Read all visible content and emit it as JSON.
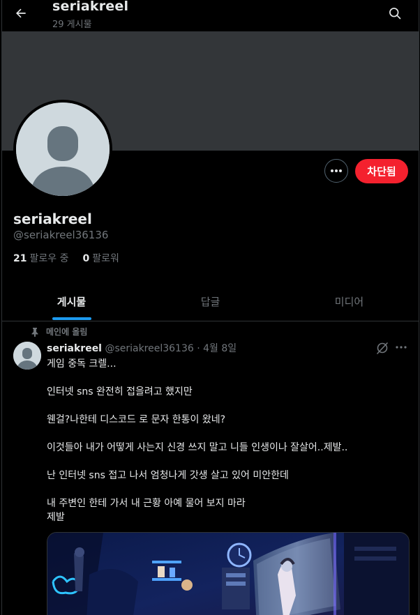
{
  "header": {
    "title": "seriakreel",
    "post_count": "29 게시물"
  },
  "profile": {
    "name": "seriakreel",
    "handle": "@seriakreel36136",
    "following_count": "21",
    "following_label": "팔로우 중",
    "followers_count": "0",
    "followers_label": "팔로워",
    "blocked_label": "차단됨",
    "accent_color": "#f4212e"
  },
  "tabs": [
    {
      "label": "게시물",
      "active": true
    },
    {
      "label": "답글",
      "active": false
    },
    {
      "label": "미디어",
      "active": false
    }
  ],
  "post": {
    "pinned_label": "메인에 올림",
    "author_name": "seriakreel",
    "author_handle": "@seriakreel36136",
    "date": "· 4월 8일",
    "lines": [
      "게임 중독 크렐...",
      "인터넷 sns 완전히 접을려고 했지만",
      "웬걸?나한테 디스코드 로 문자 한통이 왔네?",
      "이것들아 내가 어떻게 사는지 신경 쓰지 말고 니들 인생이나 잘살어..제발..",
      "난 인터넷 sns 접고 나서 엄청나게 갓생 살고 있어 미안한데",
      "내 주변인 한테 가서 내 근황 아예 물어 보지 마라",
      "제발"
    ]
  },
  "icons": {
    "back": "arrow-left-icon",
    "search": "search-icon",
    "more": "more-horizontal-icon",
    "pin": "pin-icon",
    "grok": "grok-icon"
  },
  "colors": {
    "link_blue": "#1d9bf0",
    "muted": "#71767b",
    "banner": "#333639"
  }
}
